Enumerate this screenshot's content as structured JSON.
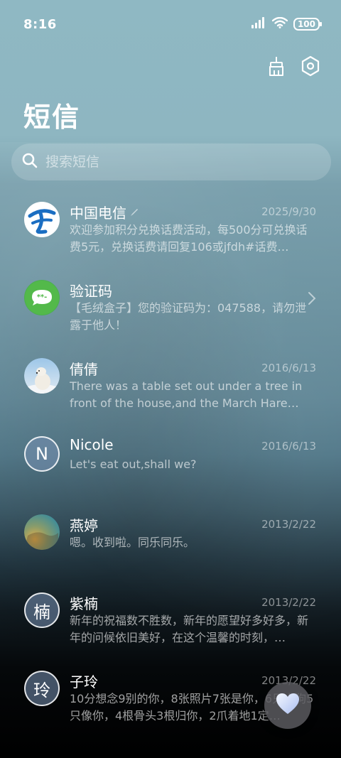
{
  "status_bar": {
    "time": "8:16",
    "battery": "100"
  },
  "header": {
    "title": "短信"
  },
  "search": {
    "placeholder": "搜索短信"
  },
  "conversations": [
    {
      "name": "中国电信",
      "date": "2025/9/30",
      "preview": "欢迎参加积分兑换话费活动，每500分可兑换话费5元，兑换话费请回复106或jfdh#话费…",
      "avatar": "china-telecom-logo-icon"
    },
    {
      "name": "验证码",
      "date": "",
      "preview": "【毛绒盒子】您的验证码为：047588，请勿泄露于他人！",
      "avatar": "message-bubble-icon"
    },
    {
      "name": "倩倩",
      "date": "2016/6/13",
      "preview": "There was a table set out under a tree in front of the house,and the March Hare an…",
      "avatar": "polar-bear-photo"
    },
    {
      "name": "Nicole",
      "date": "2016/6/13",
      "preview": "Let's eat out,shall we?",
      "avatar_letter": "N"
    },
    {
      "name": "燕婷",
      "date": "2013/2/22",
      "preview": "嗯。收到啦。同乐同乐。",
      "avatar": "landscape-photo"
    },
    {
      "name": "紫楠",
      "date": "2013/2/22",
      "preview": "新年的祝福数不胜数，新年的愿望好多好多，新年的问候依旧美好，在这个温馨的时刻，…",
      "avatar_letter": "楠"
    },
    {
      "name": "子玲",
      "date": "2013/2/22",
      "preview": "10分想念9别的你，8张照片7张是你，6只小狗5只像你，4根骨头3根归你，2爪着地1定…",
      "avatar_letter": "玲"
    }
  ],
  "fab": {
    "icon": "heart-icon"
  }
}
